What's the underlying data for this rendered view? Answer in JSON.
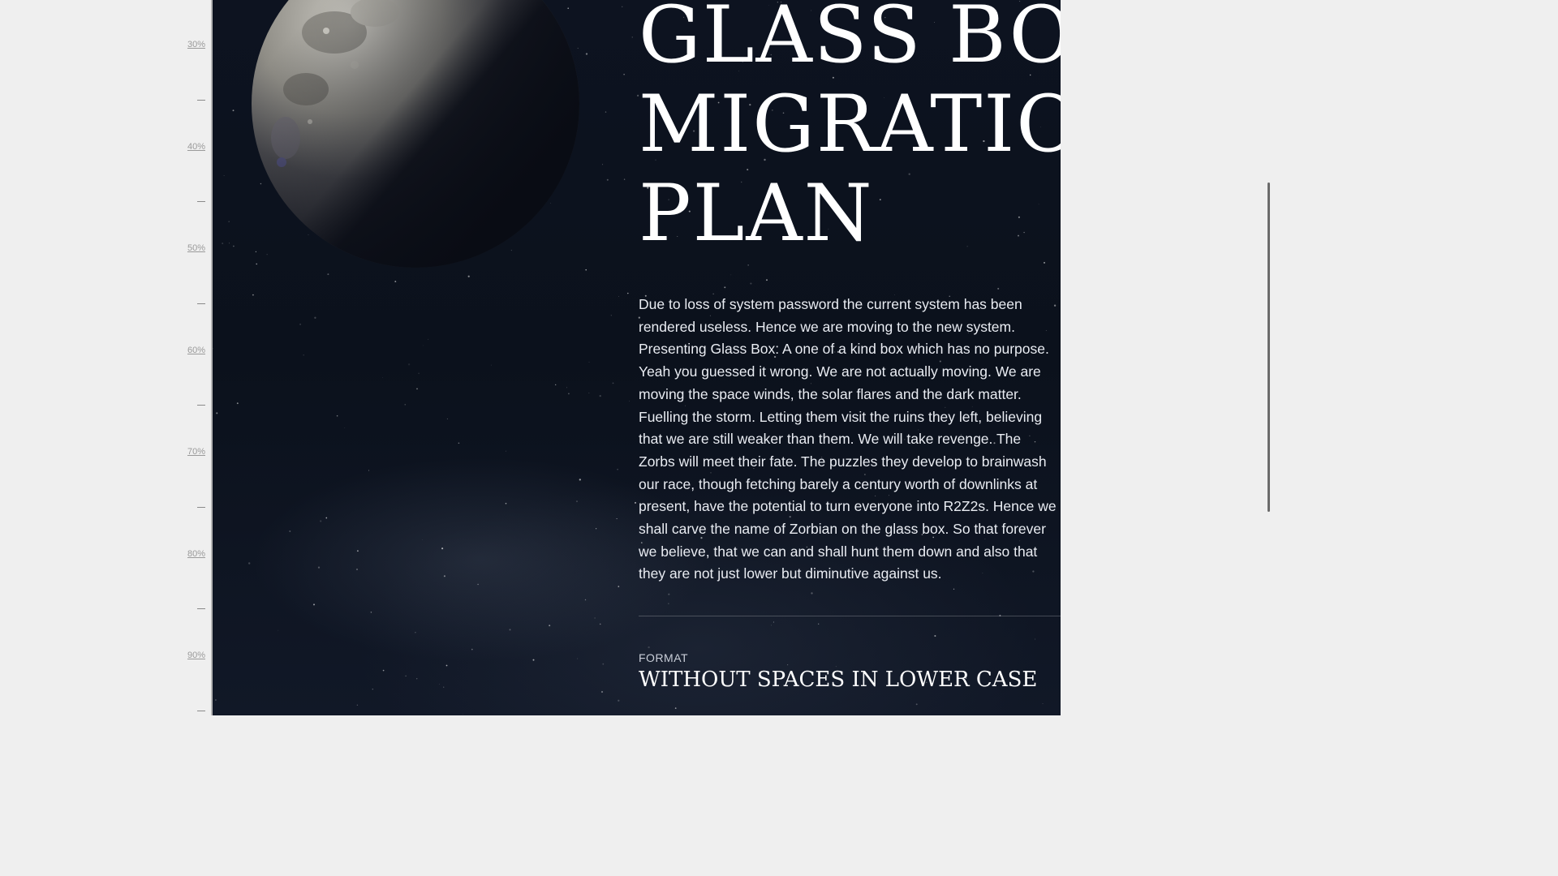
{
  "ruler": {
    "labels": [
      "30%",
      "40%",
      "50%",
      "60%",
      "70%",
      "80%",
      "90%"
    ]
  },
  "main": {
    "headline": [
      "GLASS BOX",
      "MIGRATION",
      "PLAN"
    ],
    "body": "Due to loss of system password the current system has been rendered useless. Hence we are moving to the new system. Presenting Glass Box: A one of a kind box which has no purpose. Yeah you guessed it wrong. We are not actually moving. We are moving the space winds, the solar flares and the dark matter. Fuelling the storm. Letting them visit the ruins they left, believing that we are still weaker than them. We will take revenge. The Zorbs will meet their fate. The puzzles they develop to brainwash our race, though fetching barely a century worth of downlinks at present, have the potential to turn everyone into R2Z2s. Hence we shall carve the name of Zorbian on the glass box. So that forever we believe, that we can and shall hunt them down and also that they are not just lower but diminutive against us.",
    "format_label": "FORMAT",
    "format_value": "WITHOUT SPACES IN LOWER CASE"
  },
  "icons": {
    "moon": "moon-illustration"
  },
  "colors": {
    "page_bg": "#efefef",
    "space_bg": "#0b111c",
    "text": "#ffffff"
  }
}
